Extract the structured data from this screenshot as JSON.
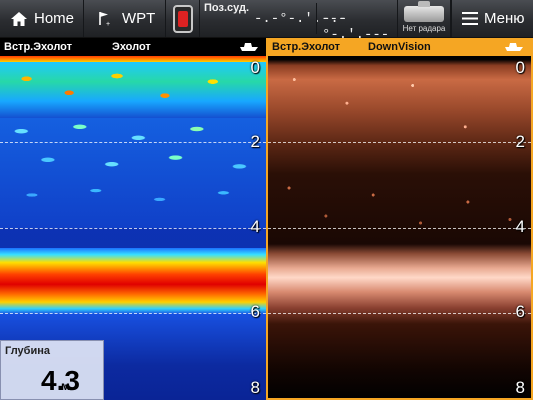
{
  "toolbar": {
    "home_label": "Home",
    "wpt_label": "WPT",
    "position_title": "Поз.суд.",
    "lat": "-.-°-.'.---",
    "lon": "-.-°-.'.---",
    "radar_label": "Нет радара",
    "menu_label": "Меню"
  },
  "left_panel": {
    "source": "Встр.Эхолот",
    "mode": "Эхолот"
  },
  "right_panel": {
    "source": "Встр.Эхолот",
    "mode": "DownVision"
  },
  "depth_scale": [
    "0",
    "2",
    "4",
    "6",
    "8"
  ],
  "depth_readout": {
    "title": "Глубина",
    "value": "4.3",
    "unit": "м"
  },
  "colors": {
    "accent": "#f5a623",
    "toolbar_bg": "#2b2d31"
  },
  "icons": [
    "home-icon",
    "waypoint-icon",
    "mob-icon",
    "radar-icon",
    "menu-icon",
    "boat-icon"
  ]
}
